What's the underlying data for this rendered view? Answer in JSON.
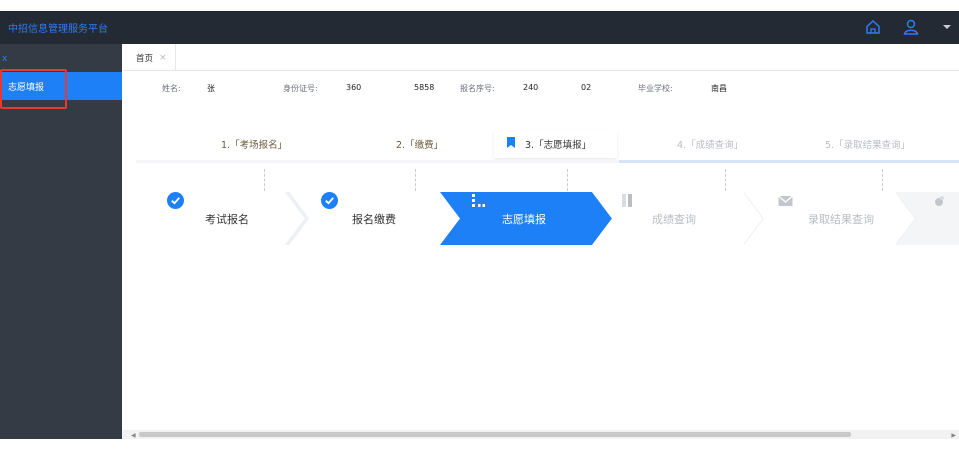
{
  "app": {
    "title": "中招信息管理服务平台"
  },
  "topbar": {
    "home_icon": "home-icon",
    "user_icon": "user-icon",
    "menu_caret": "caret-down-icon"
  },
  "sidebar": {
    "close_label": "x",
    "items": [
      {
        "label": "志愿填报",
        "active": true
      }
    ]
  },
  "tabs": [
    {
      "label": "首页",
      "close": "×"
    }
  ],
  "student": {
    "name_label": "姓名:",
    "name_value": "张",
    "id_label": "身份证号:",
    "id_value_prefix": "360",
    "id_value_suffix": "5858",
    "reg_label": "报名序号:",
    "reg_value_prefix": "240",
    "reg_value_suffix": "02",
    "school_label": "毕业学校:",
    "school_value": "南昌"
  },
  "step_headers": [
    {
      "label": "1.「考场报名」",
      "state": "done"
    },
    {
      "label": "2.「缴费」",
      "state": "done"
    },
    {
      "label": "3.「志愿填报」",
      "state": "active"
    },
    {
      "label": "4.「成绩查询」",
      "state": "todo"
    },
    {
      "label": "5.「录取结果查询」",
      "state": "todo"
    }
  ],
  "steps": [
    {
      "label": "考试报名",
      "state": "done",
      "icon": "check-circle-icon"
    },
    {
      "label": "报名缴费",
      "state": "done",
      "icon": "check-circle-icon"
    },
    {
      "label": "志愿填报",
      "state": "active",
      "icon": "list-icon"
    },
    {
      "label": "成绩查询",
      "state": "todo",
      "icon": "score-icon"
    },
    {
      "label": "录取结果查询",
      "state": "todo",
      "icon": "mail-icon"
    }
  ],
  "colors": {
    "accent": "#1e80f6",
    "topbar": "#242a33",
    "sidebar": "#353b45",
    "highlight": "#e8382f"
  }
}
